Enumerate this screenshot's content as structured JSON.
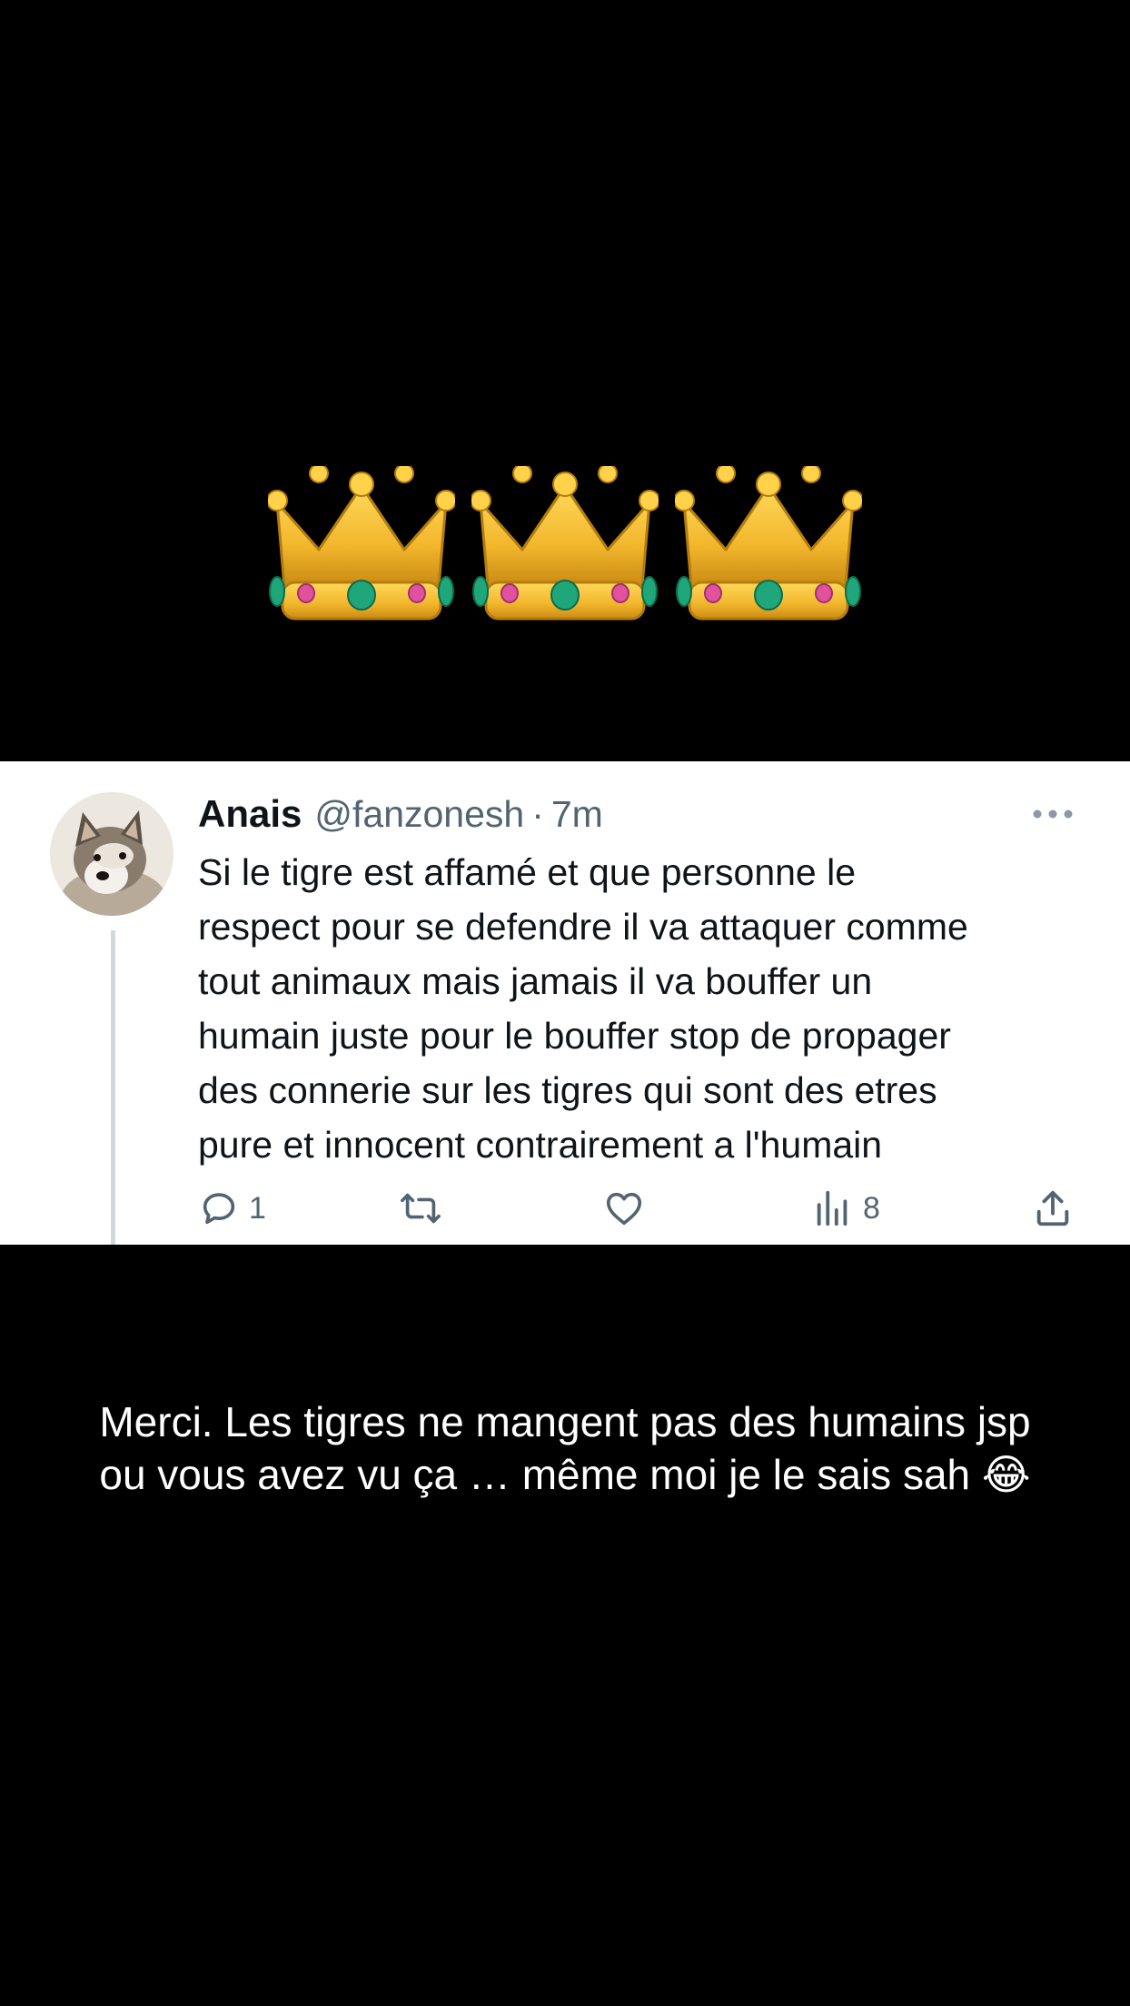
{
  "header_emojis": [
    "👑",
    "👑",
    "👑"
  ],
  "tweet": {
    "author_name": "Anais",
    "author_handle": "@fanzonesh",
    "separator": "·",
    "time_ago": "7m",
    "text": "Si le tigre est affamé et que personne le\nrespect pour se defendre il va attaquer comme\ntout animaux mais jamais il va bouffer un\nhumain juste pour le bouffer stop de propager\ndes connerie sur les tigres qui sont des etres\npure et innocent contrairement a l'humain",
    "actions": {
      "reply_count": "1",
      "retweet_count": "",
      "like_count": "",
      "views_count": "8"
    },
    "icons": {
      "reply": "reply-icon",
      "retweet": "retweet-icon",
      "like": "heart-icon",
      "views": "views-icon",
      "share": "share-icon",
      "more": "more-icon"
    }
  },
  "caption": "Merci. Les tigres ne mangent pas des humains jsp\nou vous avez vu ça … même moi je le sais sah 😂",
  "colors": {
    "background": "#000000",
    "card": "#ffffff",
    "text_primary": "#0f1419",
    "text_secondary": "#536471",
    "thread_line": "#cfd9de",
    "crown_gold": "#f2b62c",
    "crown_emerald": "#1fa67a",
    "crown_pink": "#e0529c"
  }
}
